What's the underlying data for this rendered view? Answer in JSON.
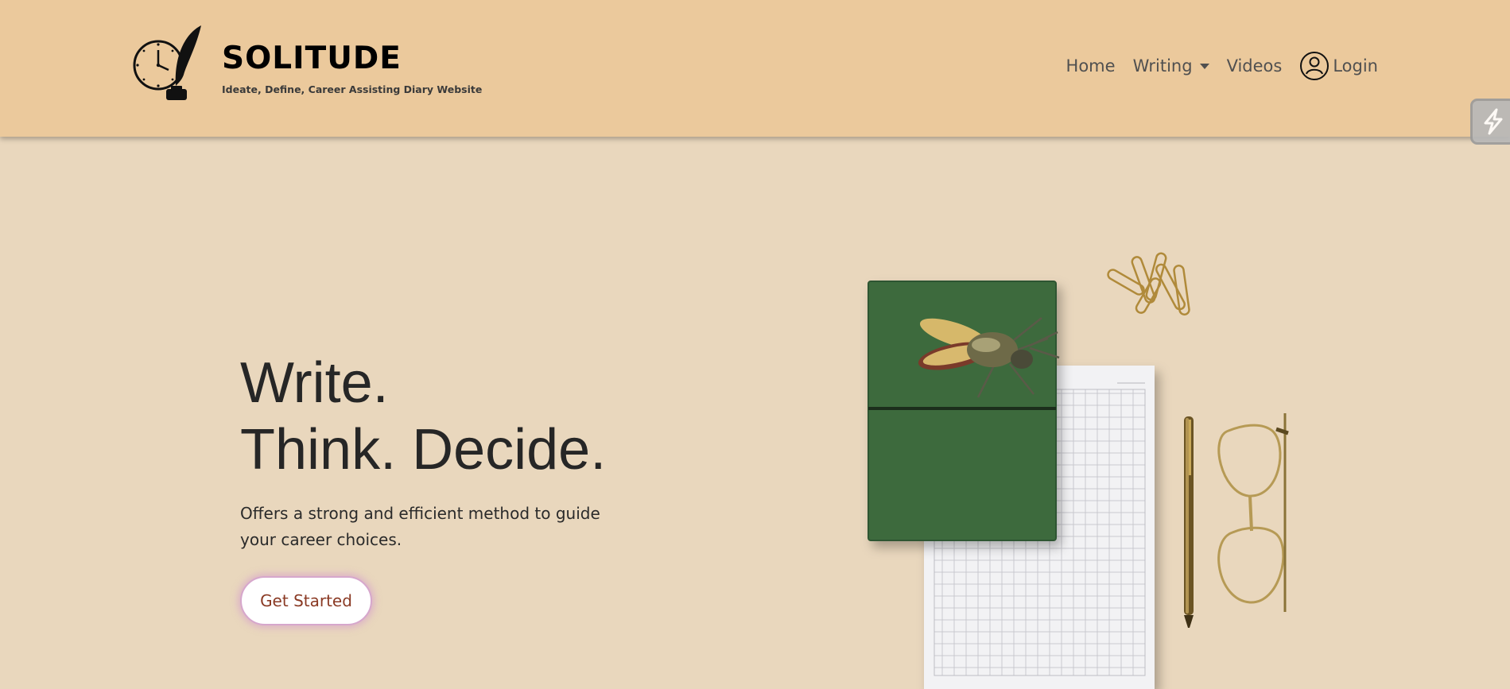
{
  "brand": {
    "title": "SOLITUDE",
    "tagline": "Ideate, Define, Career Assisting Diary Website",
    "logo_icon": "clock-quill-inkwell-logo"
  },
  "nav": {
    "home": "Home",
    "writing": "Writing",
    "videos": "Videos",
    "login": "Login",
    "login_icon": "user-circle-icon",
    "writing_icon": "caret-down-icon"
  },
  "hero": {
    "line1": "Write.",
    "line2": "Think. Decide.",
    "description": "Offers a strong and efficient method to guide your career choices.",
    "cta_label": "Get Started"
  },
  "colors": {
    "header_bg": "#ebc99c",
    "page_bg": "#e9d7bd",
    "notebook_green": "#3c6a3e",
    "cta_text": "#8a3a24",
    "cta_glow": "#d6a7cc"
  }
}
